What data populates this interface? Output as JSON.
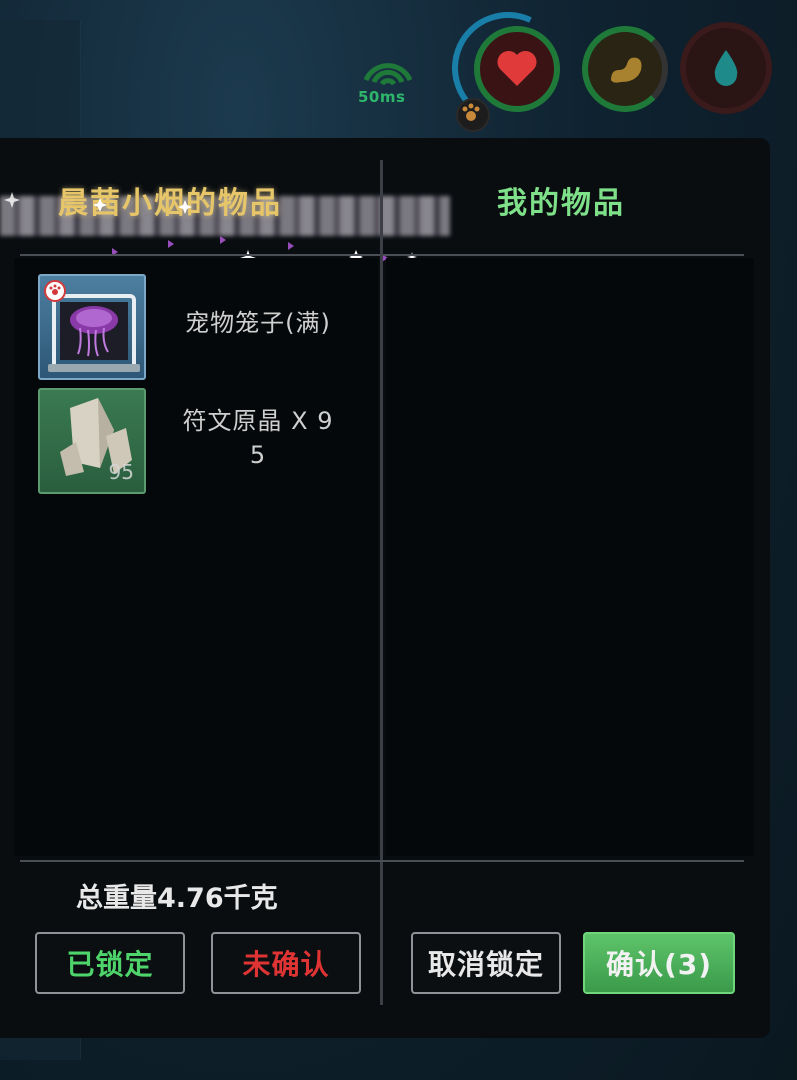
{
  "hud": {
    "ping": "50ms",
    "icons": [
      "wifi-icon",
      "heart-icon",
      "stomach-icon",
      "water-drop-icon",
      "paw-icon"
    ],
    "colors": {
      "health": "#e03a3a",
      "hunger": "#b08a30",
      "water": "#1f8a8a",
      "ring": "#1f7a3a"
    }
  },
  "trade": {
    "left_title": "晨茜小烟的物品",
    "right_title": "我的物品",
    "left_items": [
      {
        "name": "宠物笼子(满)",
        "icon": "pet-cage-icon",
        "qty": ""
      },
      {
        "name": "符文原晶 X 9\n5",
        "name_line1": "符文原晶 X 9",
        "name_line2": "5",
        "icon": "rune-crystal-icon",
        "qty": "95"
      }
    ],
    "right_items": [],
    "total_weight": "总重量4.76千克",
    "buttons": {
      "locked": "已锁定",
      "unconfirmed": "未确认",
      "unlock": "取消锁定",
      "confirm": "确认(3)"
    }
  }
}
